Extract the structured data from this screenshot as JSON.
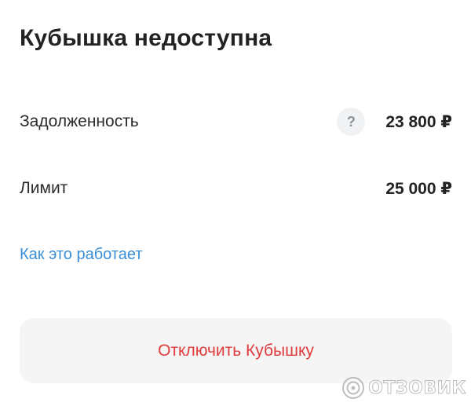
{
  "screen": {
    "title": "Кубышка недоступна"
  },
  "rows": [
    {
      "label": "Задолженность",
      "amount": "23 800 ₽",
      "help_glyph": "?"
    },
    {
      "label": "Лимит",
      "amount": "25 000 ₽"
    }
  ],
  "link": {
    "label": "Как это работает"
  },
  "action": {
    "disable_label": "Отключить Кубышку"
  },
  "watermark": {
    "text": "ОТЗОВИК",
    "icon": "otzovik-logo-icon"
  },
  "colors": {
    "text": "#222222",
    "link": "#3b8fd6",
    "danger": "#e03c3c",
    "button_bg": "#f5f5f6",
    "help_bg": "#f1f2f4"
  },
  "icons": {
    "help": "question-icon"
  }
}
